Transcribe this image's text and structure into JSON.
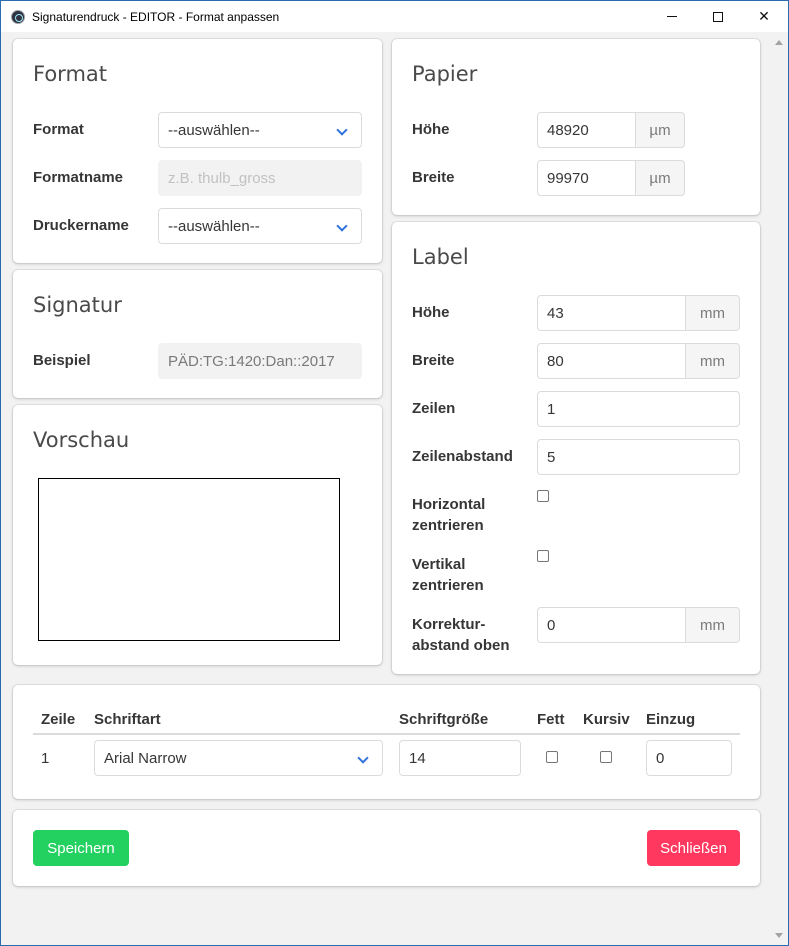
{
  "window": {
    "title": "Signaturendruck - EDITOR - Format anpassen",
    "minimize_glyph": "",
    "close_glyph": "✕"
  },
  "format_card": {
    "heading": "Format",
    "format_label": "Format",
    "format_value": "--auswählen--",
    "formatname_label": "Formatname",
    "formatname_placeholder": "z.B. thulb_gross",
    "druckername_label": "Druckername",
    "druckername_value": "--auswählen--"
  },
  "signatur_card": {
    "heading": "Signatur",
    "beispiel_label": "Beispiel",
    "beispiel_value": "PÄD:TG:1420:Dan::2017"
  },
  "vorschau_card": {
    "heading": "Vorschau"
  },
  "papier_card": {
    "heading": "Papier",
    "hoehe_label": "Höhe",
    "hoehe_value": "48920",
    "hoehe_unit": "µm",
    "breite_label": "Breite",
    "breite_value": "99970",
    "breite_unit": "µm"
  },
  "label_card": {
    "heading": "Label",
    "hoehe_label": "Höhe",
    "hoehe_value": "43",
    "hoehe_unit": "mm",
    "breite_label": "Breite",
    "breite_value": "80",
    "breite_unit": "mm",
    "zeilen_label": "Zeilen",
    "zeilen_value": "1",
    "zeilenabstand_label": "Zeilenabstand",
    "zeilenabstand_value": "5",
    "horizontal_label_1": "Horizontal",
    "horizontal_label_2": "zentrieren",
    "horizontal_checked": false,
    "vertikal_label_1": "Vertikal",
    "vertikal_label_2": "zentrieren",
    "vertikal_checked": false,
    "korrektur_label_1": "Korrektur-",
    "korrektur_label_2": "abstand oben",
    "korrektur_value": "0",
    "korrektur_unit": "mm"
  },
  "lines_table": {
    "headers": {
      "zeile": "Zeile",
      "schriftart": "Schriftart",
      "schriftgroesse": "Schriftgröße",
      "fett": "Fett",
      "kursiv": "Kursiv",
      "einzug": "Einzug"
    },
    "rows": [
      {
        "zeile": "1",
        "schriftart": "Arial Narrow",
        "schriftgroesse": "14",
        "fett": false,
        "kursiv": false,
        "einzug": "0"
      }
    ]
  },
  "actions": {
    "save_label": "Speichern",
    "close_label": "Schließen"
  },
  "colors": {
    "success": "#23d160",
    "danger": "#ff3860",
    "link": "#3273dc"
  }
}
